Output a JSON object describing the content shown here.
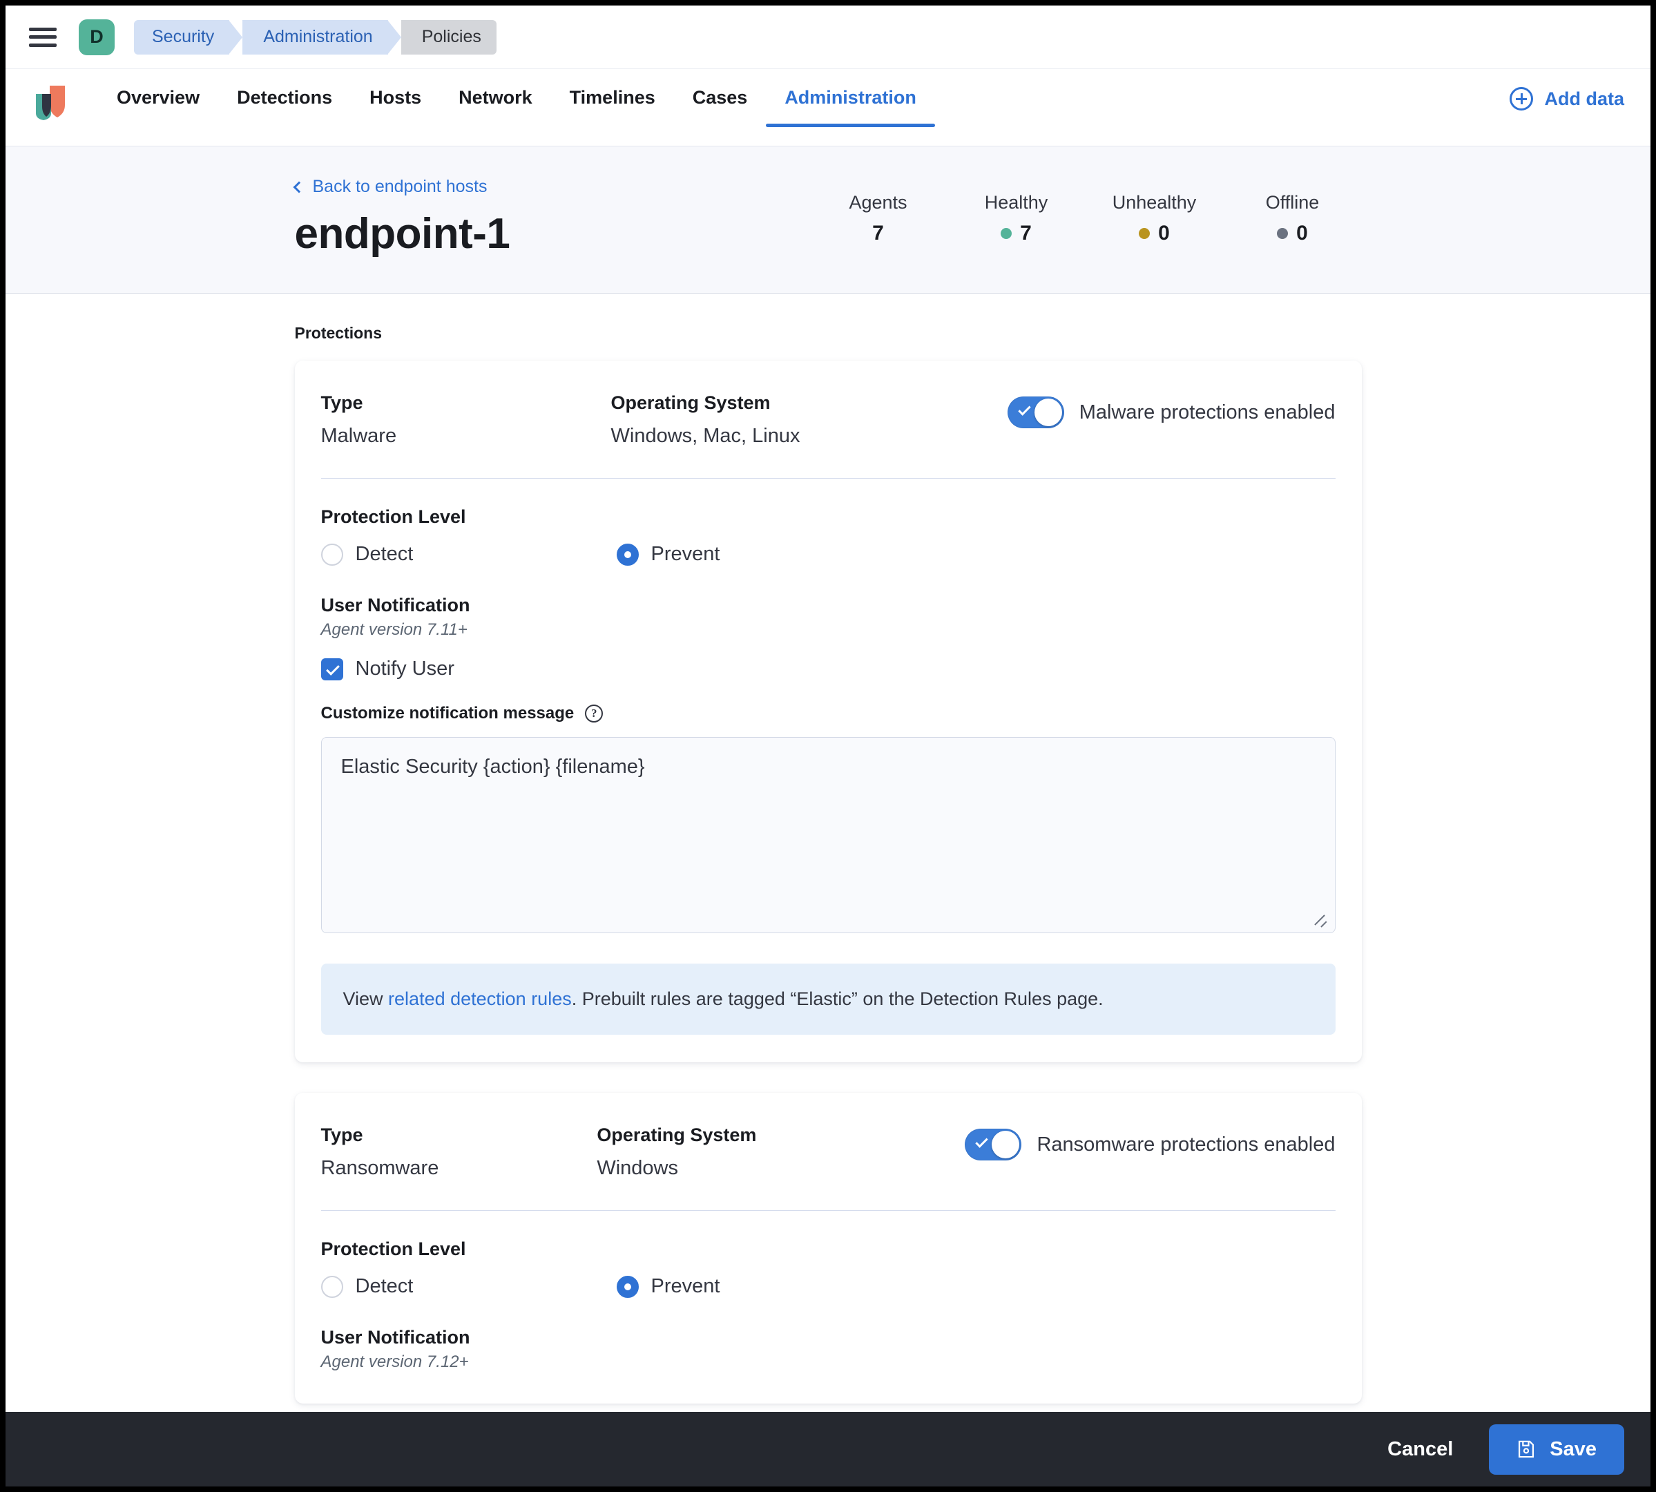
{
  "chrome": {
    "menu_icon": "hamburger-menu-icon",
    "space_avatar_initial": "D",
    "breadcrumbs": [
      {
        "label": "Security",
        "style": "blue"
      },
      {
        "label": "Administration",
        "style": "blue"
      },
      {
        "label": "Policies",
        "style": "grey"
      }
    ]
  },
  "nav": {
    "logo": "elastic-logo",
    "tabs": [
      {
        "label": "Overview",
        "active": false
      },
      {
        "label": "Detections",
        "active": false
      },
      {
        "label": "Hosts",
        "active": false
      },
      {
        "label": "Network",
        "active": false
      },
      {
        "label": "Timelines",
        "active": false
      },
      {
        "label": "Cases",
        "active": false
      },
      {
        "label": "Administration",
        "active": true
      }
    ],
    "add_data_label": "Add data",
    "add_data_icon": "plus-circle-icon",
    "accent_color": "#2f72d4"
  },
  "header": {
    "back_link": "Back to endpoint hosts",
    "back_icon": "chevron-left-icon",
    "title": "endpoint-1",
    "stats": [
      {
        "label": "Agents",
        "value": "7",
        "dot": ""
      },
      {
        "label": "Healthy",
        "value": "7",
        "dot": "#54b399"
      },
      {
        "label": "Unhealthy",
        "value": "0",
        "dot": "#b9941f"
      },
      {
        "label": "Offline",
        "value": "0",
        "dot": "#6b7280"
      }
    ]
  },
  "main": {
    "section_label": "Protections",
    "cards": [
      {
        "type_label": "Type",
        "type_value": "Malware",
        "os_label": "Operating System",
        "os_value": "Windows, Mac, Linux",
        "toggle_label": "Malware protections enabled",
        "toggle_on": true,
        "protection_level_label": "Protection Level",
        "options": [
          {
            "label": "Detect",
            "selected": false
          },
          {
            "label": "Prevent",
            "selected": true
          }
        ],
        "user_notification_label": "User Notification",
        "agent_version_note": "Agent version 7.11+",
        "notify_user_label": "Notify User",
        "notify_user_checked": true,
        "message_label": "Customize notification message",
        "message_help_icon": "question-mark-circle-icon",
        "message_value": "Elastic Security {action} {filename}",
        "callout_prefix": "View ",
        "callout_link": "related detection rules",
        "callout_suffix": ". Prebuilt rules are tagged “Elastic” on the Detection Rules page."
      },
      {
        "type_label": "Type",
        "type_value": "Ransomware",
        "os_label": "Operating System",
        "os_value": "Windows",
        "toggle_label": "Ransomware protections enabled",
        "toggle_on": true,
        "protection_level_label": "Protection Level",
        "options": [
          {
            "label": "Detect",
            "selected": false
          },
          {
            "label": "Prevent",
            "selected": true
          }
        ],
        "user_notification_label": "User Notification",
        "agent_version_note": "Agent version 7.12+"
      }
    ]
  },
  "bottom_bar": {
    "cancel_label": "Cancel",
    "save_label": "Save",
    "save_icon": "floppy-disk-save-icon",
    "background": "#25282f",
    "save_color": "#2f72d4"
  }
}
